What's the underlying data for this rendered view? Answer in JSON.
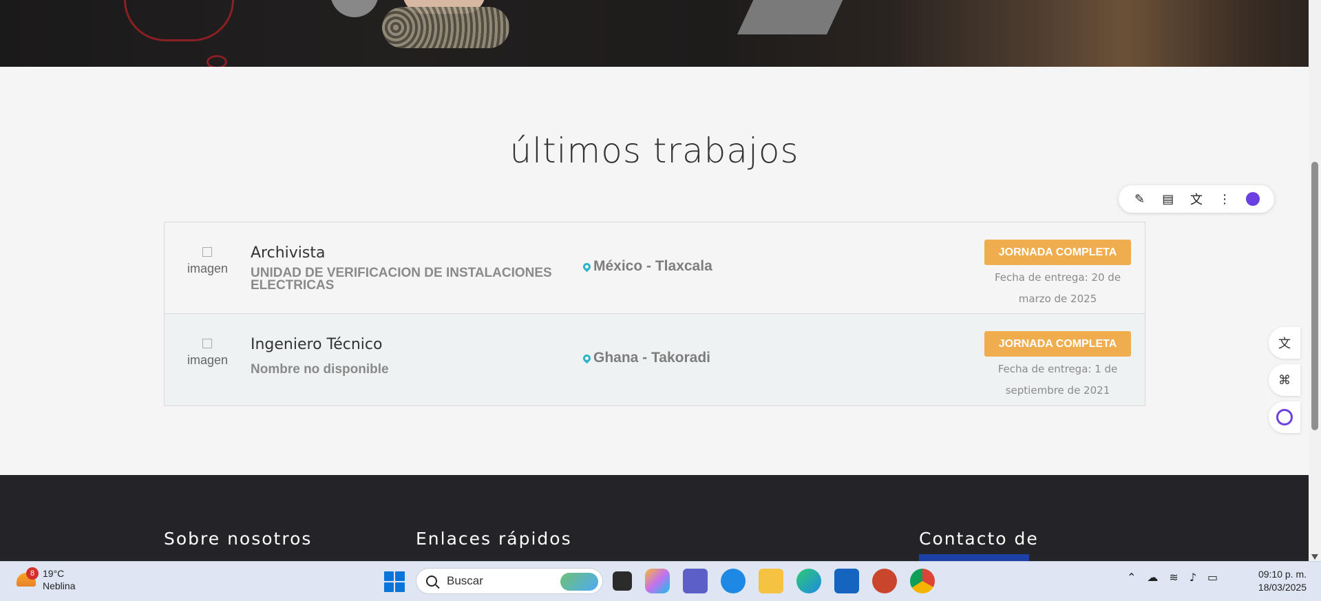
{
  "section": {
    "title": "últimos trabajos"
  },
  "jobs": [
    {
      "image_alt": "imagen",
      "title": "Archivista",
      "company": "UNIDAD DE VERIFICACION DE INSTALACIONES ELECTRICAS",
      "location": "México - Tlaxcala",
      "badge": "JORNADA COMPLETA",
      "date": "Fecha de entrega: 20 de marzo de 2025"
    },
    {
      "image_alt": "imagen",
      "title": "Ingeniero Técnico",
      "company": "Nombre no disponible",
      "location": "Ghana - Takoradi",
      "badge": "JORNADA COMPLETA",
      "date": "Fecha de entrega: 1 de septiembre de 2021"
    }
  ],
  "footer": {
    "col1": "Sobre nosotros",
    "col2": "Enlaces rápidos",
    "col3": "Contacto de"
  },
  "taskbar": {
    "weather_badge": "8",
    "temperature": "19°C",
    "condition": "Neblina",
    "search_placeholder": "Buscar",
    "time": "09:10 p. m.",
    "date": "18/03/2025"
  },
  "colors": {
    "badge": "#f0ad4e",
    "pin": "#2ab3c7",
    "footer_bg": "#232328"
  }
}
